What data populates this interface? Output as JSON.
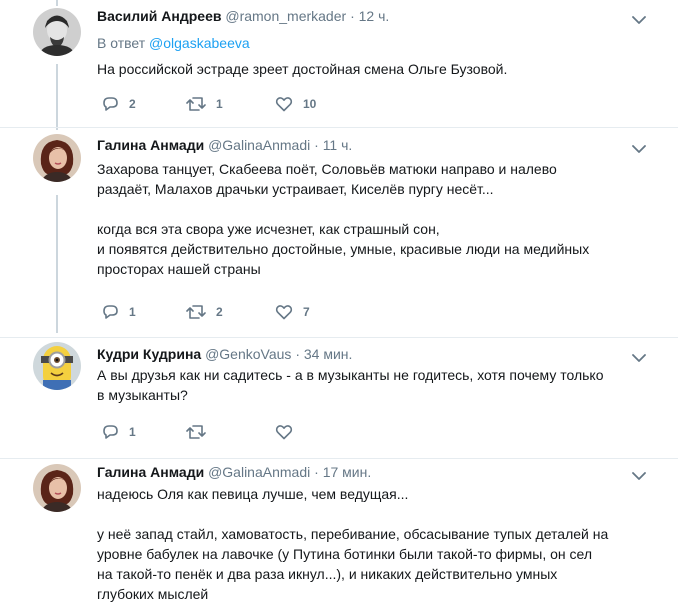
{
  "tweets": [
    {
      "name": "Василий Андреев",
      "handle": "@ramon_merkader",
      "dot": "·",
      "time": "12 ч.",
      "reply_prefix": "В ответ",
      "reply_handle": "@olgaskabeeva",
      "lines": [
        "На российской эстраде зреет достойная смена Ольге Бузовой."
      ],
      "replies": "2",
      "retweets": "1",
      "likes": "10"
    },
    {
      "name": "Галина Анмади",
      "handle": "@GalinaAnmadi",
      "dot": "·",
      "time": "11 ч.",
      "lines": [
        "Захарова танцует, Скабеева поёт, Соловьёв матюки направо и налево",
        "раздаёт, Малахов драчьки  устраивает, Киселёв пургу несёт...",
        "",
        "когда вся эта свора уже исчезнет, как страшный сон,",
        "и появятся действительно достойные, умные, красивые люди на медийных",
        "просторах нашей страны"
      ],
      "replies": "1",
      "retweets": "2",
      "likes": "7"
    },
    {
      "name": "Кудри Кудрина",
      "handle": "@GenkoVaus",
      "dot": "·",
      "time": "34 мин.",
      "lines": [
        "А вы друзья как ни садитесь - а в музыканты не годитесь, хотя почему только",
        "в музыканты?"
      ],
      "replies": "1",
      "retweets": "",
      "likes": ""
    },
    {
      "name": "Галина Анмади",
      "handle": "@GalinaAnmadi",
      "dot": "·",
      "time": "17 мин.",
      "lines": [
        "надеюсь Оля как певица лучше, чем ведущая...",
        "",
        "у неё запад стайл, хамоватость, перебивание, обсасывание тупых деталей на",
        "уровне бабулек на лавочке (у Путина ботинки были такой-то фирмы, он сел",
        "на такой-то пенёк и два раза икнул...), и никаких действительно умных",
        "глубоких мыслей"
      ]
    }
  ],
  "colors": {
    "icon": "#657786",
    "link": "#1da1f2",
    "thread_line": "#ccd6dd",
    "divider": "#e6ecf0"
  }
}
